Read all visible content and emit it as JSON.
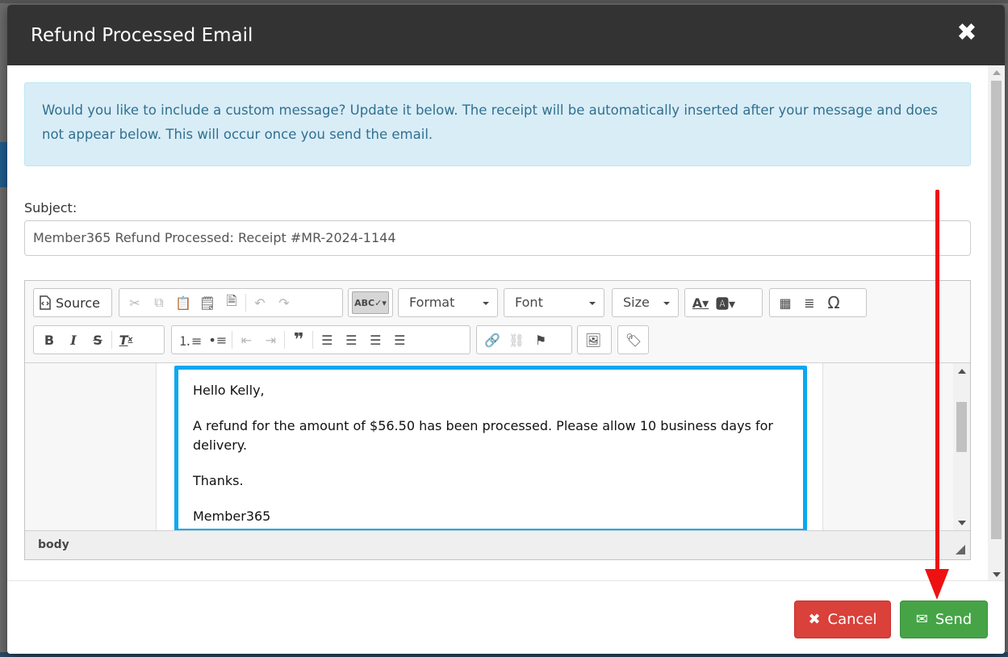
{
  "modal": {
    "title": "Refund Processed Email",
    "close_icon": "close-icon"
  },
  "alert": {
    "text": "Would you like to include a custom message? Update it below. The receipt will be automatically inserted after your message and does not appear below. This will occur once you send the email."
  },
  "subject": {
    "label": "Subject:",
    "value": "Member365 Refund Processed: Receipt #MR-2024-1144"
  },
  "toolbar": {
    "source_label": "Source",
    "format_label": "Format",
    "font_label": "Font",
    "size_label": "Size"
  },
  "editor": {
    "paragraphs": [
      "Hello Kelly,",
      "A refund for the amount of $56.50 has been processed. Please allow 10 business days for delivery.",
      "Thanks.",
      "Member365"
    ],
    "status_path": "body"
  },
  "footer": {
    "cancel_label": "Cancel",
    "send_label": "Send"
  },
  "colors": {
    "header_bg": "#333333",
    "alert_bg": "#d9edf7",
    "cancel_bg": "#d9413a",
    "send_bg": "#46a447",
    "highlight": "#0aa8f0",
    "annotation_arrow": "#ee1111"
  }
}
